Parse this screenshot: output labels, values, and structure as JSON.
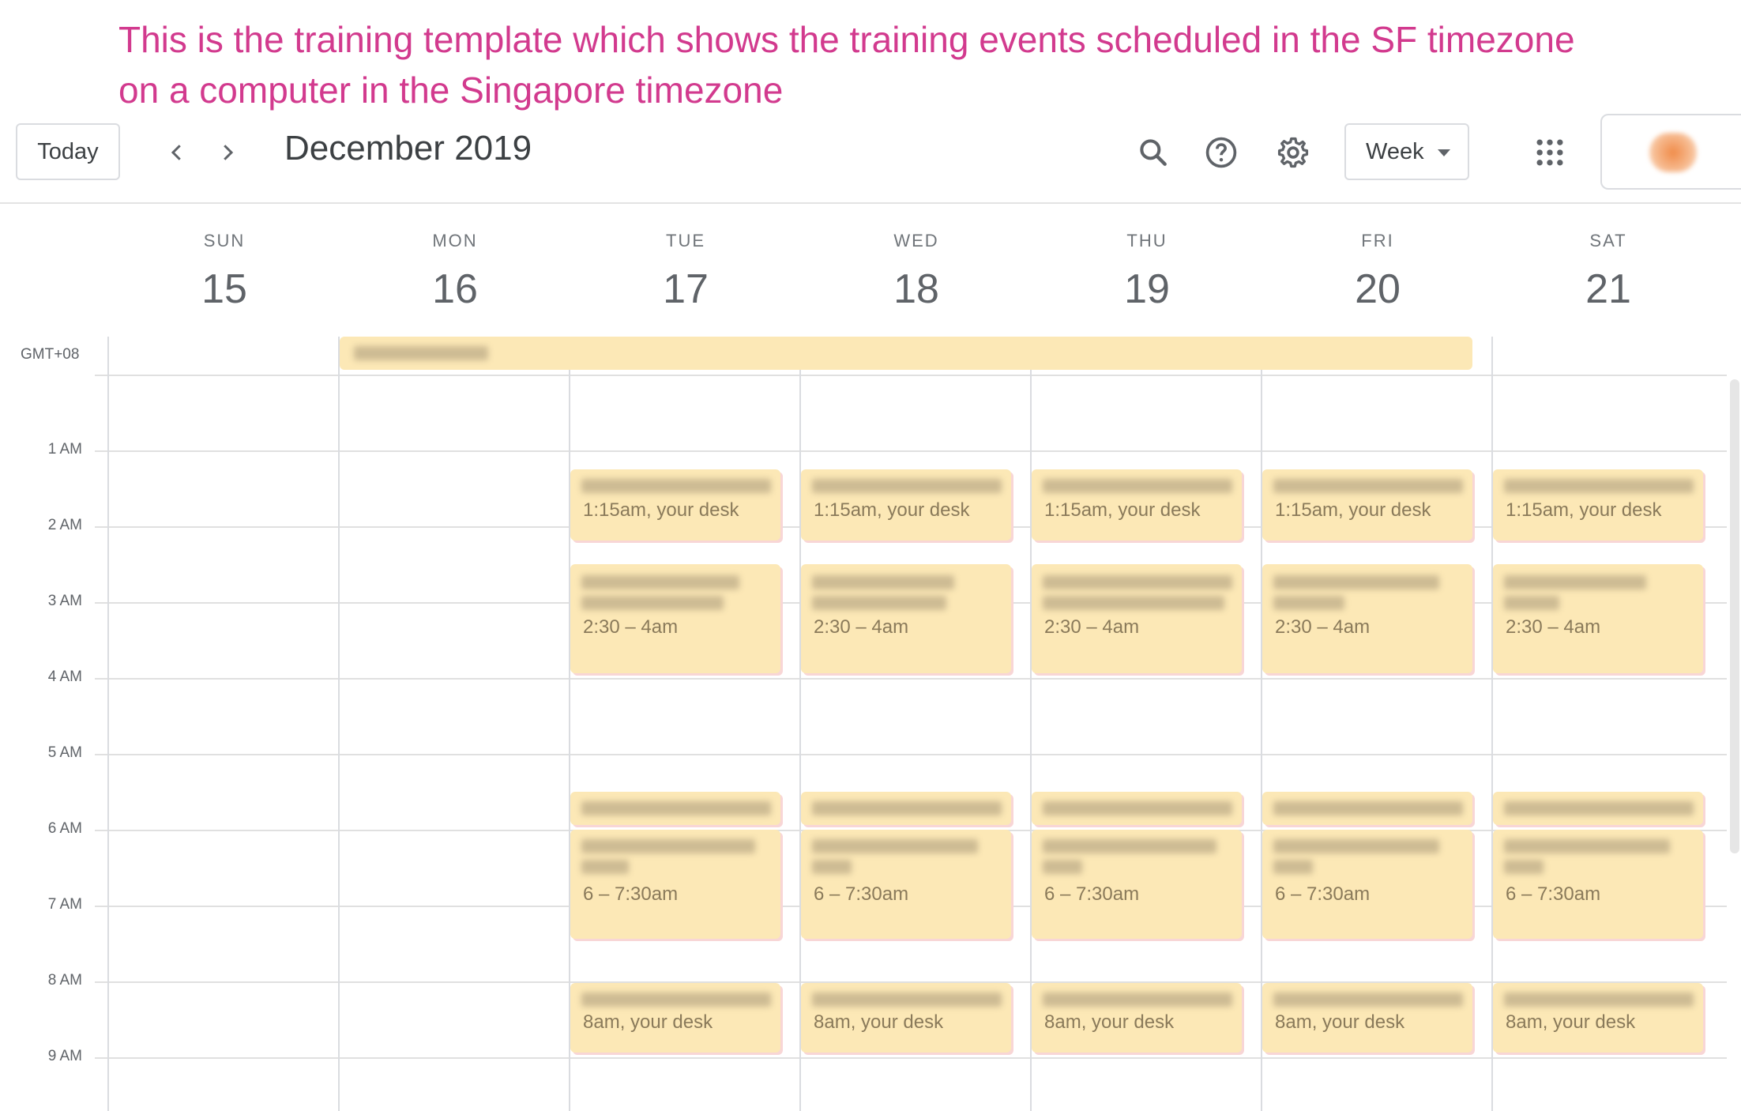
{
  "annotation": {
    "line1": "This is the training template which shows the training events scheduled in the SF timezone",
    "line2": "on a computer in the Singapore timezone"
  },
  "header": {
    "today_label": "Today",
    "month_title": "December 2019",
    "view_label": "Week",
    "icons": [
      "chevron-left-icon",
      "chevron-right-icon",
      "search-icon",
      "help-icon",
      "gear-icon",
      "apps-grid-icon"
    ]
  },
  "days": [
    {
      "dow": "SUN",
      "num": "15"
    },
    {
      "dow": "MON",
      "num": "16"
    },
    {
      "dow": "TUE",
      "num": "17"
    },
    {
      "dow": "WED",
      "num": "18"
    },
    {
      "dow": "THU",
      "num": "19"
    },
    {
      "dow": "FRI",
      "num": "20"
    },
    {
      "dow": "SAT",
      "num": "21"
    }
  ],
  "timezone": "GMT+08",
  "hours": [
    "1 AM",
    "2 AM",
    "3 AM",
    "4 AM",
    "5 AM",
    "6 AM",
    "7 AM",
    "8 AM",
    "9 AM"
  ],
  "events": {
    "slot1_time": "1:15am, your desk",
    "slot2_time": "2:30 – 4am",
    "slot3_time": "6 – 7:30am",
    "slot4_time": "8am, your desk"
  },
  "colors": {
    "event_bg": "#fce8b6",
    "annotation": "#d23a8e"
  }
}
